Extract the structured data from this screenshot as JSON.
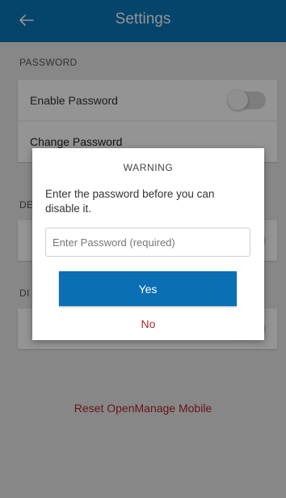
{
  "appbar": {
    "title": "Settings",
    "back_icon": "arrow-left-icon",
    "color": "#0a75b8"
  },
  "password_section": {
    "header": "PASSWORD",
    "enable_label": "Enable Password",
    "enable_on": false,
    "change_label": "Change Password"
  },
  "hidden_section_2": {
    "header_visible": "DE"
  },
  "hidden_section_3": {
    "header_visible": "DI"
  },
  "reset_label": "Reset OpenManage Mobile",
  "dialog": {
    "title": "WARNING",
    "message": "Enter the password before you can disable it.",
    "input_placeholder": "Enter Password (required)",
    "input_value": "",
    "yes_label": "Yes",
    "no_label": "No",
    "accent": "#0a6fb3",
    "danger": "#b4262a"
  }
}
